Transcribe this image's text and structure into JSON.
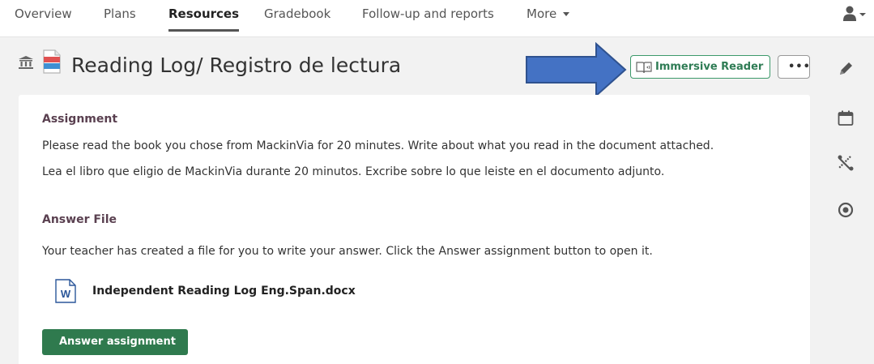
{
  "nav": {
    "tabs": [
      {
        "label": "Overview"
      },
      {
        "label": "Plans"
      },
      {
        "label": "Resources"
      },
      {
        "label": "Gradebook"
      },
      {
        "label": "Follow-up and reports"
      },
      {
        "label": "More"
      }
    ],
    "active_tab": "Resources"
  },
  "page": {
    "title": "Reading Log/ Registro de lectura"
  },
  "toolbar": {
    "immersive_reader_label": "Immersive Reader",
    "more_label": "•••"
  },
  "assignment": {
    "heading": "Assignment",
    "lines": [
      "Please read the book you chose from MackinVia for 20 minutes. Write about what you read in the document attached.",
      "Lea el libro que eligio de MackinVia durante 20 minutos. Excribe sobre lo que leiste en el documento adjunto."
    ]
  },
  "answer_file": {
    "heading": "Answer File",
    "description": "Your teacher has created a file for you to write your answer. Click the Answer assignment button to open it.",
    "file_name": "Independent Reading Log Eng.Span.docx",
    "file_icon_letter": "W",
    "button_label": "Answer assignment"
  },
  "sidebar": {
    "icons": [
      "pencil-icon",
      "calendar-icon",
      "tools-icon",
      "target-icon"
    ]
  },
  "colors": {
    "accent_green": "#2f7a4e",
    "arrow_blue": "#4472c4",
    "heading_plum": "#5a4050",
    "word_blue": "#2b579a"
  }
}
